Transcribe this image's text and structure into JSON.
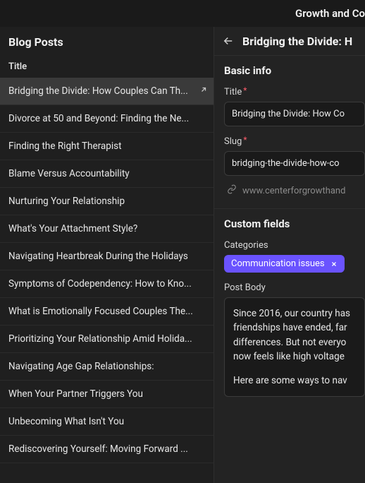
{
  "top_header": {
    "title": "Growth and Co"
  },
  "sidebar": {
    "title": "Blog Posts",
    "column_header": "Title",
    "selected_index": 0,
    "posts": [
      {
        "title": "Bridging the Divide: How Couples Can Th..."
      },
      {
        "title": "Divorce at 50 and Beyond: Finding the Ne..."
      },
      {
        "title": "Finding the Right Therapist"
      },
      {
        "title": "Blame Versus Accountability"
      },
      {
        "title": "Nurturing Your Relationship"
      },
      {
        "title": "What's Your Attachment Style?"
      },
      {
        "title": "Navigating Heartbreak During the Holidays"
      },
      {
        "title": "Symptoms of Codependency: How to Kno..."
      },
      {
        "title": "What is Emotionally Focused Couples The..."
      },
      {
        "title": "Prioritizing Your Relationship Amid Holida..."
      },
      {
        "title": "Navigating Age Gap Relationships:"
      },
      {
        "title": "When Your Partner Triggers You"
      },
      {
        "title": "Unbecoming What Isn't You"
      },
      {
        "title": "Rediscovering Yourself: Moving Forward ..."
      }
    ]
  },
  "detail": {
    "header_title": "Bridging the Divide: H",
    "basic_info": {
      "heading": "Basic info",
      "title_label": "Title",
      "title_value": "Bridging the Divide: How Co",
      "slug_label": "Slug",
      "slug_value": "bridging-the-divide-how-co",
      "url_preview": "www.centerforgrowthand"
    },
    "custom_fields": {
      "heading": "Custom fields",
      "categories_label": "Categories",
      "category_tag": "Communication issues",
      "post_body_label": "Post Body",
      "post_body_p1": "Since 2016, our country has friendships have ended, far differences. But not everyo now feels like high voltage",
      "post_body_p2": "Here are some ways to nav"
    }
  }
}
